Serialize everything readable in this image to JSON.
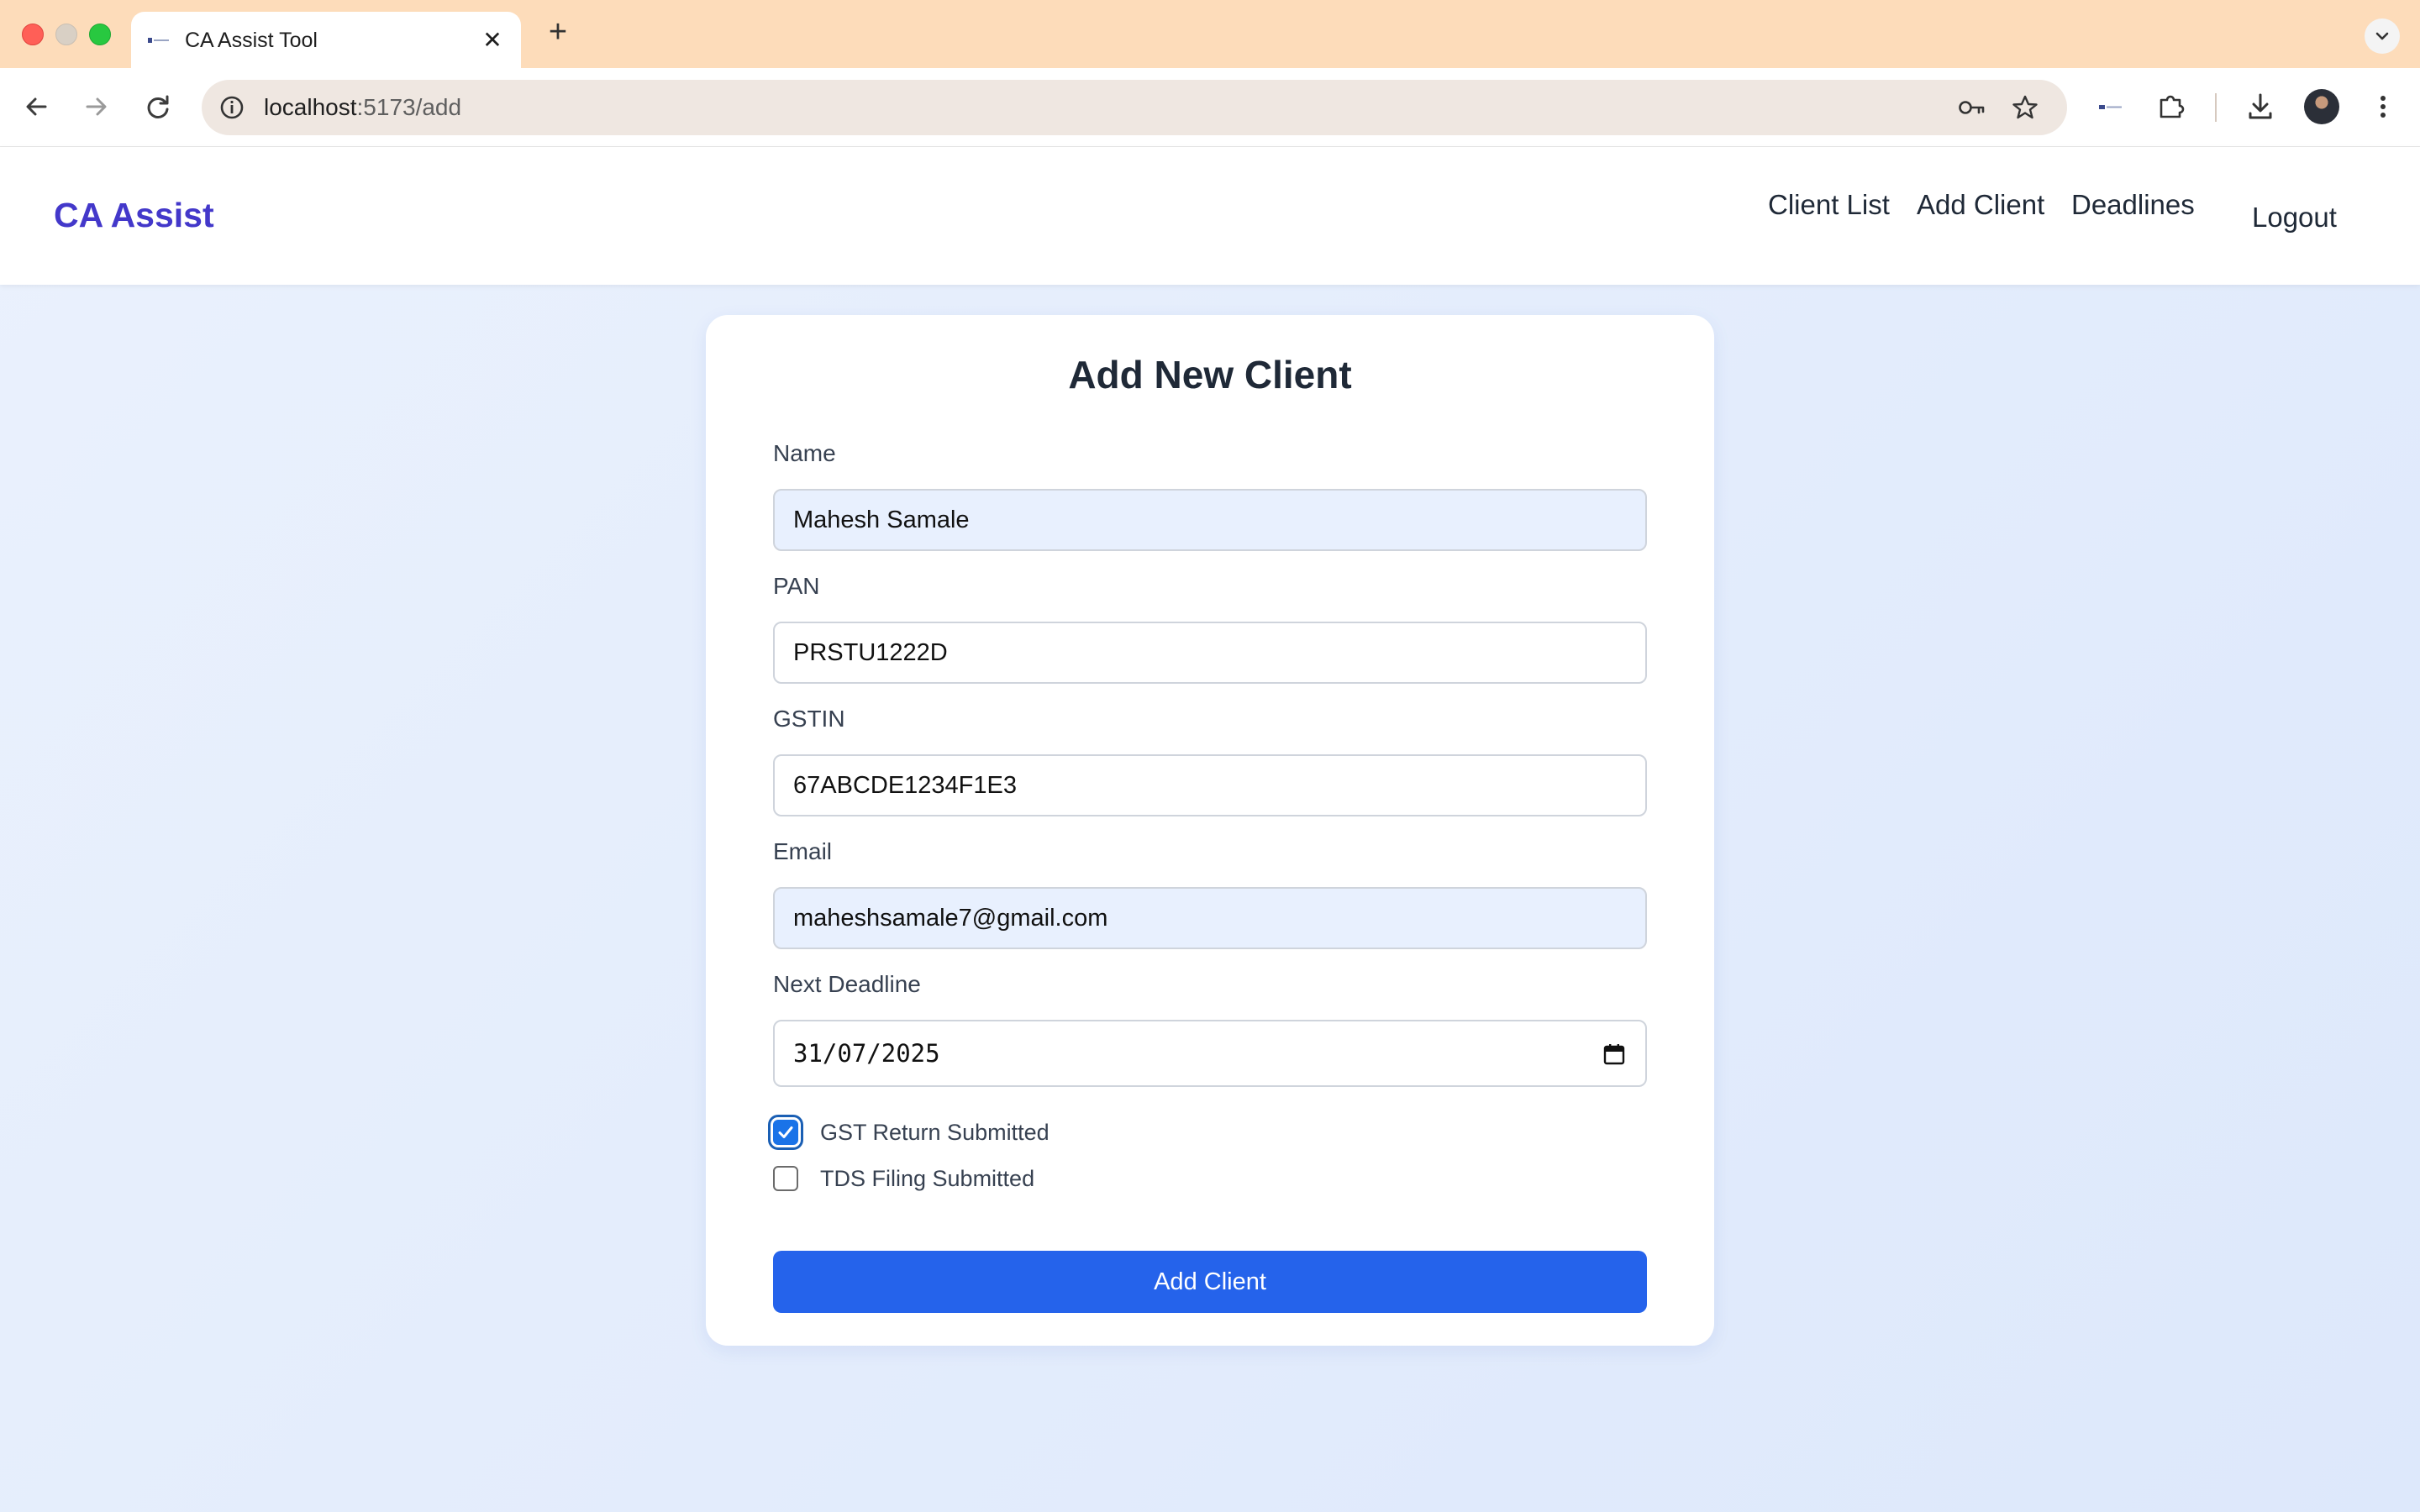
{
  "browser": {
    "tab_title": "CA Assist Tool",
    "tab_close": "✕",
    "new_tab": "+",
    "url_host": "localhost",
    "url_path": ":5173/add"
  },
  "navbar": {
    "brand": "CA Assist",
    "links": [
      "Client List",
      "Add Client",
      "Deadlines"
    ],
    "logout": "Logout"
  },
  "form": {
    "title": "Add New Client",
    "fields": [
      {
        "label": "Name",
        "value": "Mahesh Samale"
      },
      {
        "label": "PAN",
        "value": "PRSTU1222D"
      },
      {
        "label": "GSTIN",
        "value": "67ABCDE1234F1E3"
      },
      {
        "label": "Email",
        "value": "maheshsamale7@gmail.com"
      },
      {
        "label": "Next Deadline",
        "value": "31/07/2025"
      }
    ],
    "checkboxes": [
      {
        "label": "GST Return Submitted",
        "checked": true
      },
      {
        "label": "TDS Filing Submitted",
        "checked": false
      }
    ],
    "submit_label": "Add Client"
  },
  "colors": {
    "brand": "#4338ca",
    "primary_button": "#2563eb",
    "tab_strip": "#fddcba"
  },
  "icons": [
    "back-arrow-icon",
    "forward-arrow-icon",
    "reload-icon",
    "info-icon",
    "password-key-icon",
    "bookmark-star-icon",
    "extension-icon",
    "download-icon",
    "more-vertical-icon",
    "calendar-icon",
    "checkmark-icon"
  ]
}
